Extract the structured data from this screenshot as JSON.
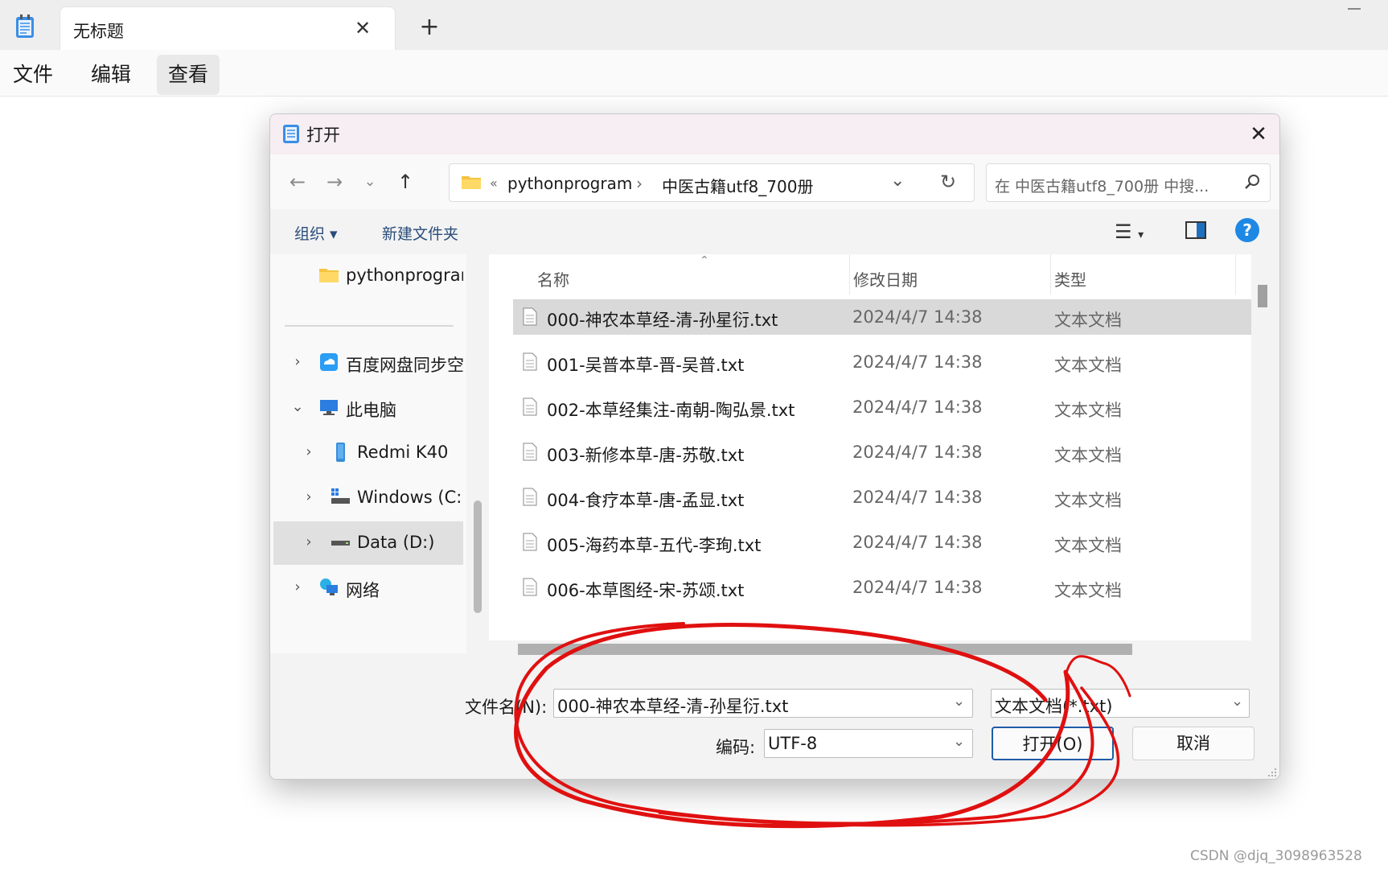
{
  "app": {
    "tab_title": "无标题",
    "menu": [
      "文件",
      "编辑",
      "查看"
    ]
  },
  "dialog": {
    "title": "打开",
    "breadcrumb_prefix": "«",
    "breadcrumb": [
      "pythonprogram",
      "中医古籍utf8_700册"
    ],
    "search_placeholder": "在 中医古籍utf8_700册 中搜...",
    "toolbar": {
      "organize": "组织 ▾",
      "new_folder": "新建文件夹"
    },
    "nav_pane": [
      {
        "label": "pythonprogram",
        "icon": "folder-icon"
      },
      {
        "label": "百度网盘同步空间",
        "icon": "cloud-drive-icon"
      },
      {
        "label": "此电脑",
        "icon": "computer-icon"
      },
      {
        "label": "Redmi K40",
        "icon": "phone-icon"
      },
      {
        "label": "Windows (C:)",
        "icon": "drive-icon"
      },
      {
        "label": "Data (D:)",
        "icon": "drive-icon"
      },
      {
        "label": "网络",
        "icon": "network-icon"
      }
    ],
    "columns": {
      "name": "名称",
      "date": "修改日期",
      "type": "类型"
    },
    "files": [
      {
        "name": "000-神农本草经-清-孙星衍.txt",
        "date": "2024/4/7 14:38",
        "type": "文本文档"
      },
      {
        "name": "001-吴普本草-晋-吴普.txt",
        "date": "2024/4/7 14:38",
        "type": "文本文档"
      },
      {
        "name": "002-本草经集注-南朝-陶弘景.txt",
        "date": "2024/4/7 14:38",
        "type": "文本文档"
      },
      {
        "name": "003-新修本草-唐-苏敬.txt",
        "date": "2024/4/7 14:38",
        "type": "文本文档"
      },
      {
        "name": "004-食疗本草-唐-孟显.txt",
        "date": "2024/4/7 14:38",
        "type": "文本文档"
      },
      {
        "name": "005-海药本草-五代-李珣.txt",
        "date": "2024/4/7 14:38",
        "type": "文本文档"
      },
      {
        "name": "006-本草图经-宋-苏颂.txt",
        "date": "2024/4/7 14:38",
        "type": "文本文档"
      }
    ],
    "footer": {
      "filename_label": "文件名(N):",
      "filename_value": "000-神农本草经-清-孙星衍.txt",
      "filetype_value": "文本文档(*.txt)",
      "encoding_label": "编码:",
      "encoding_value": "UTF-8",
      "open_button": "打开(O)",
      "cancel_button": "取消"
    }
  },
  "watermark": "CSDN @djq_3098963528",
  "colors": {
    "accent": "#1e88e5",
    "annotation": "#e01010"
  }
}
